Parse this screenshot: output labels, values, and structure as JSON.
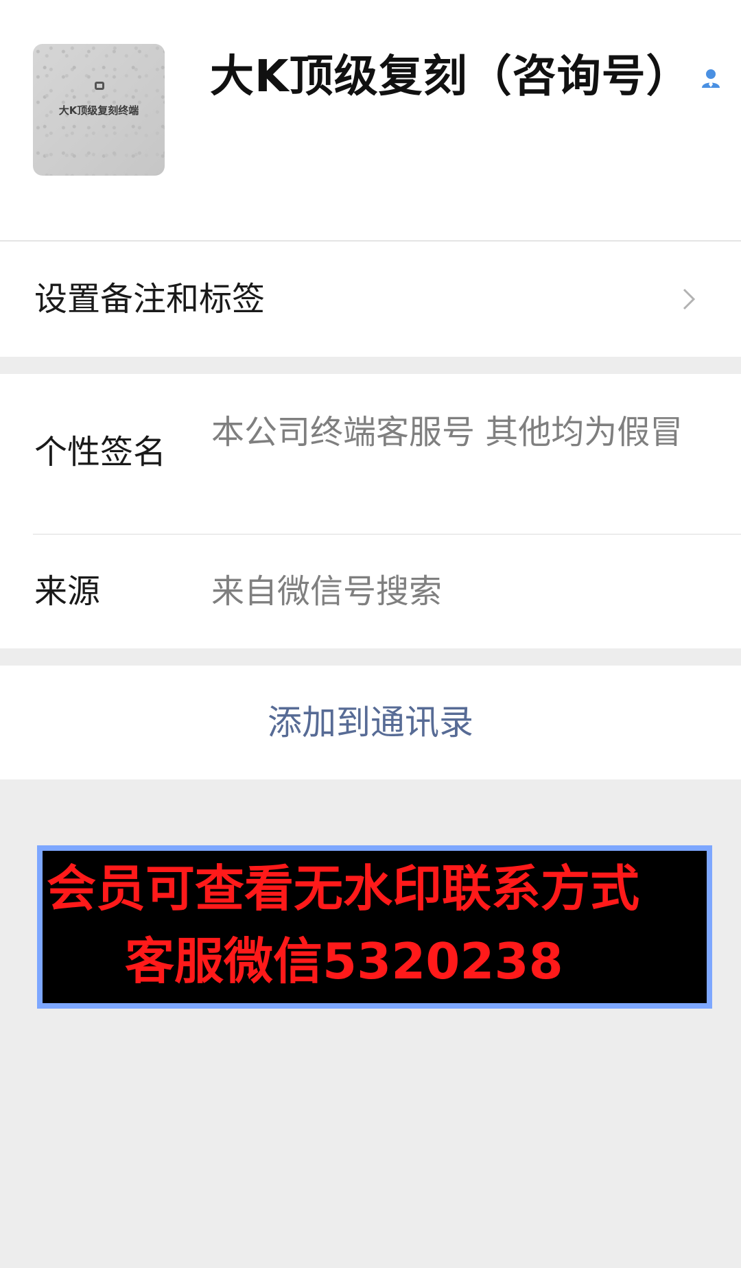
{
  "profile": {
    "name": "大K顶级复刻（咨询号）",
    "avatar_text": "大K顶级复刻终端",
    "person_icon": "person-icon"
  },
  "remark": {
    "label": "设置备注和标签",
    "chevron_icon": "chevron-right-icon"
  },
  "info": {
    "signature_label": "个性签名",
    "signature_value": "本公司终端客服号 其他均为假冒",
    "source_label": "来源",
    "source_value": "来自微信号搜索"
  },
  "actions": {
    "add_contact_label": "添加到通讯录"
  },
  "banner": {
    "line1": "会员可查看无水印联系方式",
    "line2": "客服微信5320238"
  },
  "colors": {
    "background": "#ededed",
    "link": "#576b95",
    "value_text": "#7f7f7f",
    "banner_text": "#ff1a1a",
    "banner_border": "#7da7ff",
    "verified_icon": "#4a90e2"
  }
}
